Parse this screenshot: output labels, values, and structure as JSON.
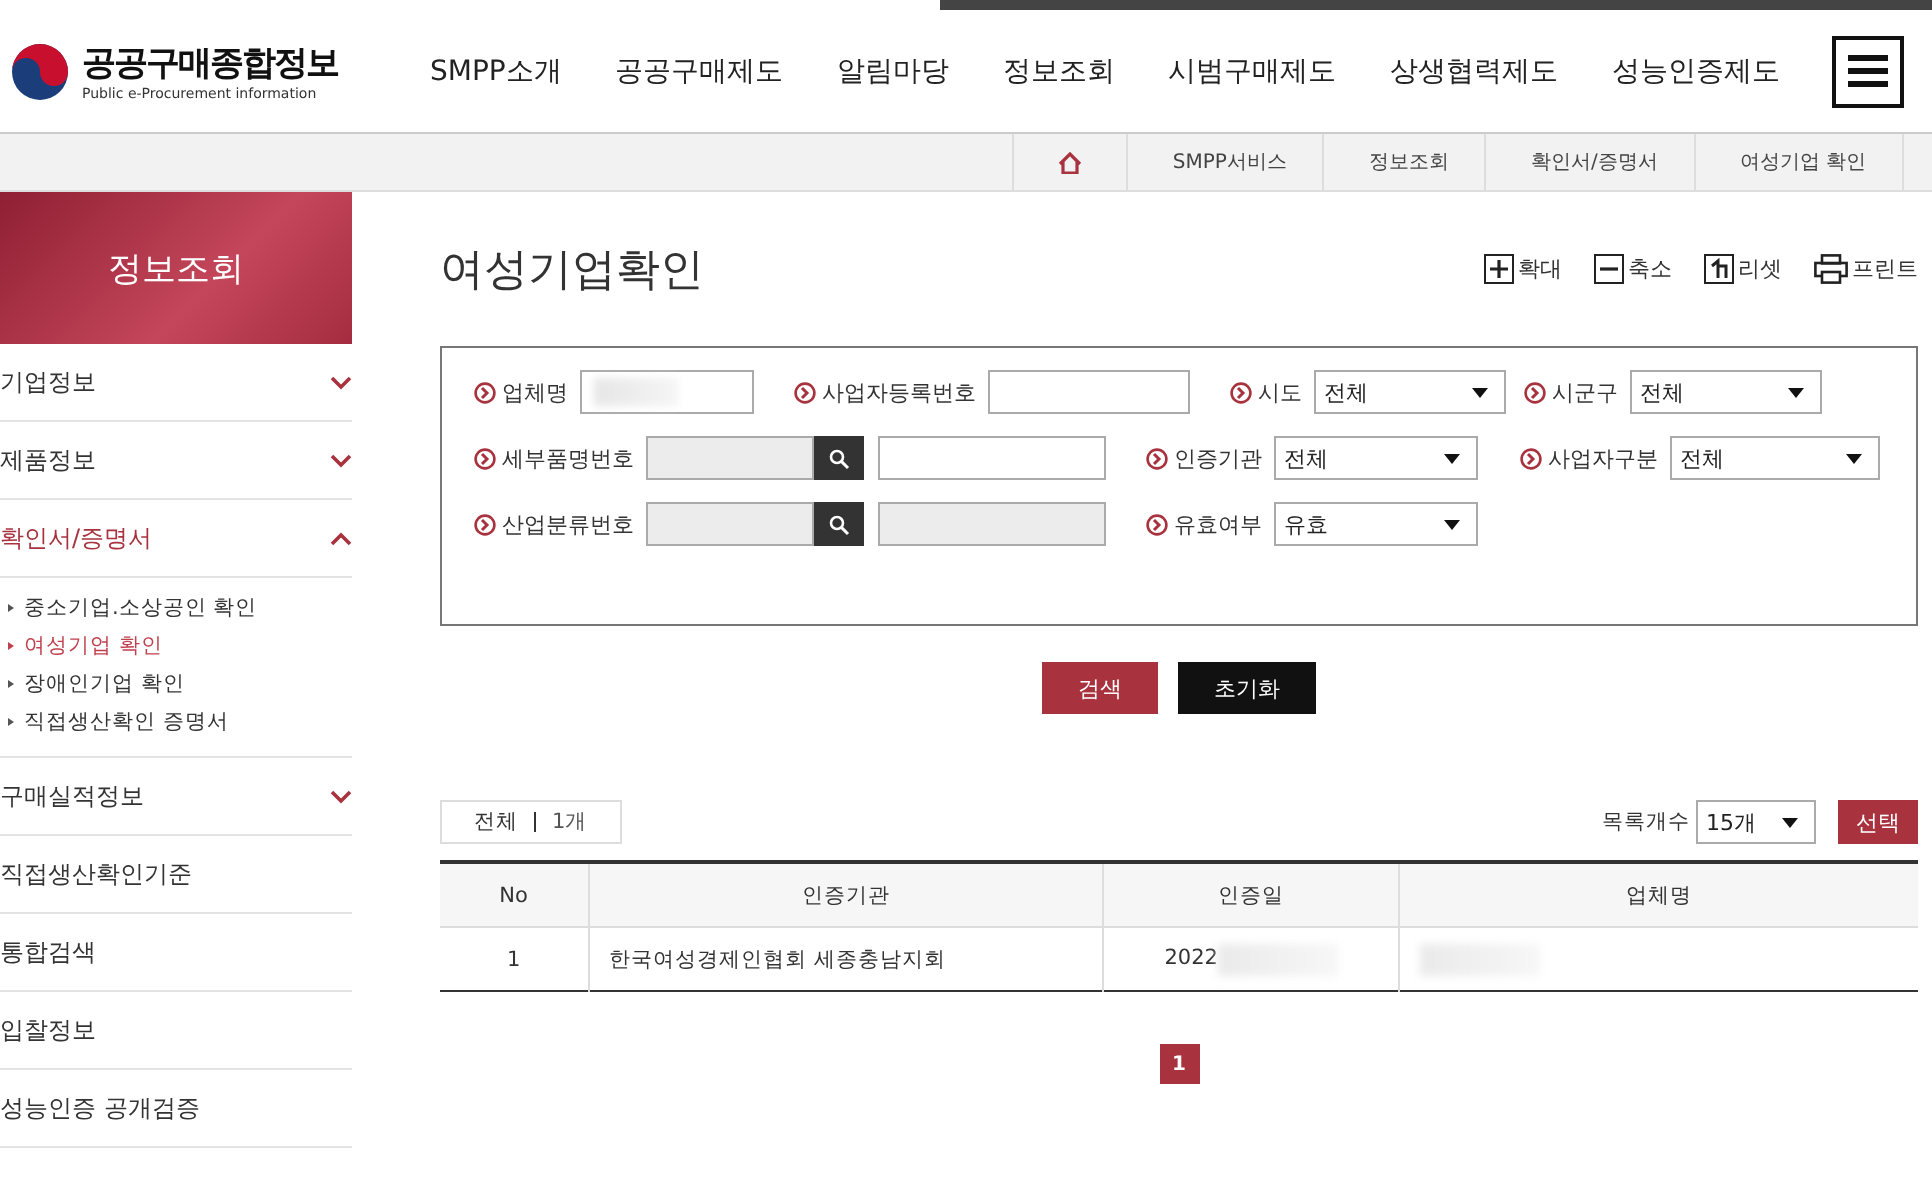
{
  "header": {
    "logo_title": "공공구매종합정보",
    "logo_subtitle": "Public e-Procurement information",
    "nav": [
      "SMPP소개",
      "공공구매제도",
      "알림마당",
      "정보조회",
      "시범구매제도",
      "상생협력제도",
      "성능인증제도"
    ]
  },
  "breadcrumb": [
    "SMPP서비스",
    "정보조회",
    "확인서/증명서",
    "여성기업 확인"
  ],
  "sidebar": {
    "title": "정보조회",
    "items": [
      {
        "label": "기업정보",
        "expanded": false,
        "selected": false
      },
      {
        "label": "제품정보",
        "expanded": false,
        "selected": false
      },
      {
        "label": "확인서/증명서",
        "expanded": true,
        "selected": true,
        "children": [
          {
            "label": "중소기업.소상공인 확인",
            "selected": false
          },
          {
            "label": "여성기업 확인",
            "selected": true
          },
          {
            "label": "장애인기업 확인",
            "selected": false
          },
          {
            "label": "직접생산확인 증명서",
            "selected": false
          }
        ]
      },
      {
        "label": "구매실적정보",
        "expanded": false,
        "selected": false
      },
      {
        "label": "직접생산확인기준",
        "selected": false
      },
      {
        "label": "통합검색",
        "selected": false
      },
      {
        "label": "입찰정보",
        "selected": false
      },
      {
        "label": "성능인증 공개검증",
        "selected": false
      }
    ]
  },
  "page_title": "여성기업확인",
  "tools": [
    {
      "kind": "zoom-in",
      "label": "확대"
    },
    {
      "kind": "zoom-out",
      "label": "축소"
    },
    {
      "kind": "reset",
      "label": "리셋"
    },
    {
      "kind": "print",
      "label": "프린트"
    }
  ],
  "filters": [
    [
      {
        "label": "업체명",
        "kind": "text",
        "blurred": true
      },
      {
        "label": "사업자등록번호",
        "kind": "text"
      },
      {
        "label": "시도",
        "kind": "select",
        "value": "전체"
      },
      {
        "label": "시군구",
        "kind": "select",
        "value": "전체"
      }
    ],
    [
      {
        "label": "세부품명번호",
        "kind": "lookup",
        "disabled": false
      },
      {
        "label": "인증기관",
        "kind": "select",
        "value": "전체"
      },
      {
        "label": "사업자구분",
        "kind": "select",
        "value": "전체"
      }
    ],
    [
      {
        "label": "산업분류번호",
        "kind": "lookup",
        "disabled": true
      },
      {
        "label": "유효여부",
        "kind": "select",
        "value": "유효"
      }
    ]
  ],
  "actions": [
    {
      "kind": "primary",
      "label": "검색"
    },
    {
      "kind": "dark",
      "label": "초기화"
    }
  ],
  "result": {
    "total_label": "전체",
    "total_count": "1개",
    "page_size_label": "목록개수",
    "page_size": "15개",
    "apply_button": "선택"
  },
  "table": {
    "columns": [
      "No",
      "인증기관",
      "인증일",
      "업체명"
    ],
    "rows": [
      [
        {
          "text": "1"
        },
        {
          "text": "한국여성경제인협회 세종충남지회"
        },
        {
          "text": "2022",
          "blurred": true
        },
        {
          "blurred": true
        }
      ]
    ]
  },
  "pagination": [
    {
      "label": "1",
      "selected": true
    }
  ]
}
